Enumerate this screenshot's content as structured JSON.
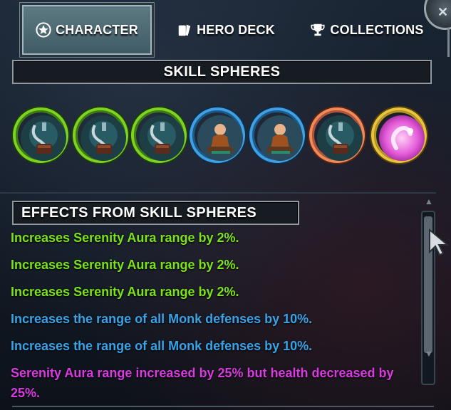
{
  "tabs": [
    {
      "label": "CHARACTER",
      "icon": "star-badge-icon",
      "active": true
    },
    {
      "label": "HERO DECK",
      "icon": "cards-icon",
      "active": false
    },
    {
      "label": "COLLECTIONS",
      "icon": "trophy-icon",
      "active": false
    }
  ],
  "skill_spheres": {
    "title": "SKILL SPHERES",
    "spheres": [
      {
        "icon": "serenity-aura-icon",
        "ring": "green"
      },
      {
        "icon": "serenity-aura-icon",
        "ring": "green"
      },
      {
        "icon": "serenity-aura-icon",
        "ring": "green"
      },
      {
        "icon": "monk-icon",
        "ring": "blue"
      },
      {
        "icon": "monk-icon",
        "ring": "blue"
      },
      {
        "icon": "serenity-aura-icon",
        "ring": "orange"
      },
      {
        "icon": "pink-swirl-icon",
        "ring": "gold"
      }
    ]
  },
  "effects": {
    "title": "EFFECTS FROM SKILL SPHERES",
    "items": [
      {
        "text": "Increases Serenity Aura range by 2%.",
        "color": "green"
      },
      {
        "text": "Increases Serenity Aura range by 2%.",
        "color": "green"
      },
      {
        "text": "Increases Serenity Aura range by 2%.",
        "color": "green"
      },
      {
        "text": "Increases the range of all Monk defenses by 10%.",
        "color": "blue"
      },
      {
        "text": "Increases the range of all Monk defenses by 10%.",
        "color": "blue"
      },
      {
        "text": "Serenity Aura range increased by 25% but health decreased by 25%.",
        "color": "purple"
      }
    ]
  },
  "colors": {
    "green_text": "#7ce21a",
    "blue_text": "#39a3e8",
    "purple_text": "#d83be0",
    "active_tab": "#4f6b75"
  }
}
